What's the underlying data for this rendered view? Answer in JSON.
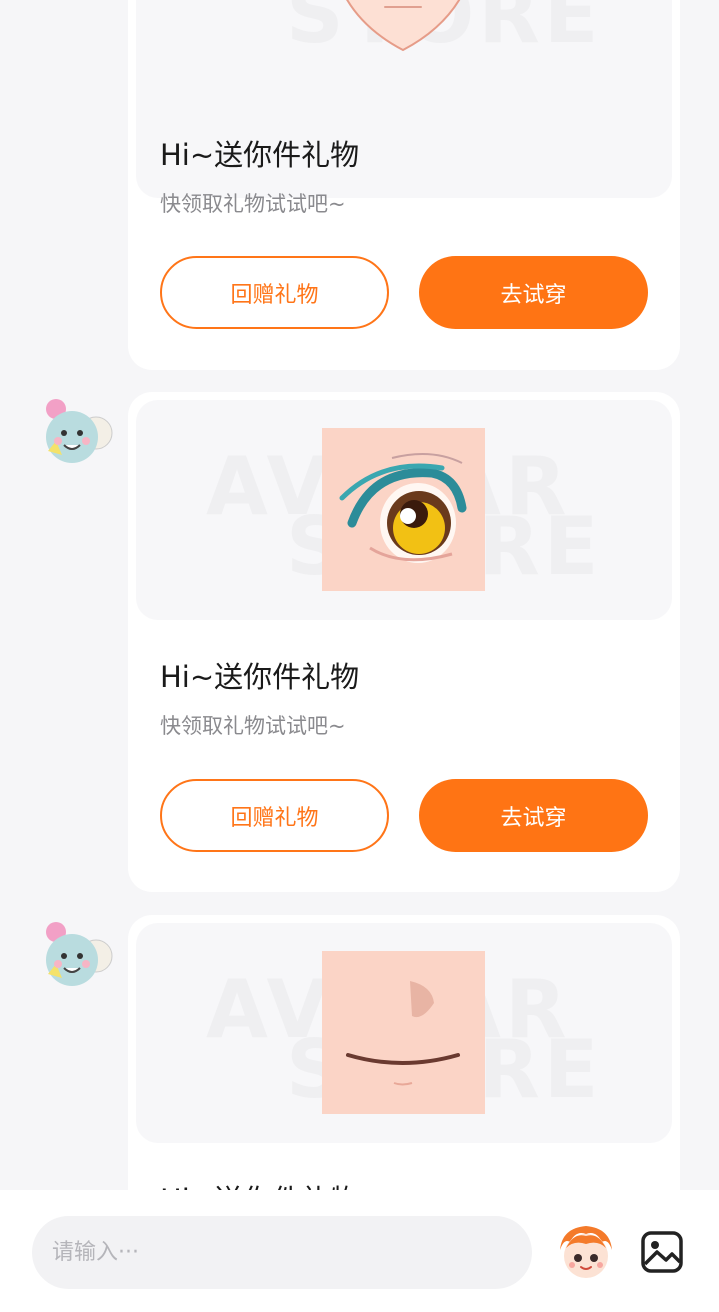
{
  "messages": [
    {
      "title": "Hi~送你件礼物",
      "subtitle": "快领取礼物试试吧~",
      "return_gift_label": "回赠礼物",
      "try_on_label": "去试穿",
      "item_icon": "face-chin-icon"
    },
    {
      "title": "Hi~送你件礼物",
      "subtitle": "快领取礼物试试吧~",
      "return_gift_label": "回赠礼物",
      "try_on_label": "去试穿",
      "item_icon": "anime-eye-icon",
      "sender_avatar": "cute-mascot-avatar"
    },
    {
      "title": "Hi~送你件礼物",
      "item_icon": "nose-mouth-icon",
      "sender_avatar": "cute-mascot-avatar"
    }
  ],
  "watermark": {
    "line1": "AVATAR",
    "line2": "STORE"
  },
  "composer": {
    "placeholder": "请输入···",
    "emoji_button_icon": "mascot-face-icon",
    "image_button_icon": "image-icon"
  },
  "colors": {
    "accent": "#ff7414",
    "page_bg": "#f6f6f8",
    "card_bg": "#ffffff",
    "skin": "#fbd4c6"
  }
}
